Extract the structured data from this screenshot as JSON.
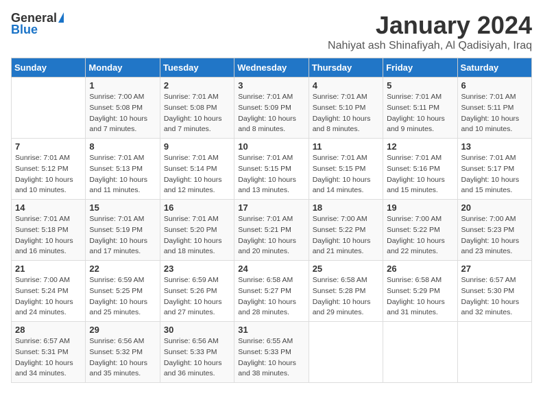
{
  "header": {
    "logo_general": "General",
    "logo_blue": "Blue",
    "month_title": "January 2024",
    "location": "Nahiyat ash Shinafiyah, Al Qadisiyah, Iraq"
  },
  "calendar": {
    "days_of_week": [
      "Sunday",
      "Monday",
      "Tuesday",
      "Wednesday",
      "Thursday",
      "Friday",
      "Saturday"
    ],
    "weeks": [
      [
        {
          "day": "",
          "sunrise": "",
          "sunset": "",
          "daylight": ""
        },
        {
          "day": "1",
          "sunrise": "Sunrise: 7:00 AM",
          "sunset": "Sunset: 5:08 PM",
          "daylight": "Daylight: 10 hours and 7 minutes."
        },
        {
          "day": "2",
          "sunrise": "Sunrise: 7:01 AM",
          "sunset": "Sunset: 5:08 PM",
          "daylight": "Daylight: 10 hours and 7 minutes."
        },
        {
          "day": "3",
          "sunrise": "Sunrise: 7:01 AM",
          "sunset": "Sunset: 5:09 PM",
          "daylight": "Daylight: 10 hours and 8 minutes."
        },
        {
          "day": "4",
          "sunrise": "Sunrise: 7:01 AM",
          "sunset": "Sunset: 5:10 PM",
          "daylight": "Daylight: 10 hours and 8 minutes."
        },
        {
          "day": "5",
          "sunrise": "Sunrise: 7:01 AM",
          "sunset": "Sunset: 5:11 PM",
          "daylight": "Daylight: 10 hours and 9 minutes."
        },
        {
          "day": "6",
          "sunrise": "Sunrise: 7:01 AM",
          "sunset": "Sunset: 5:11 PM",
          "daylight": "Daylight: 10 hours and 10 minutes."
        }
      ],
      [
        {
          "day": "7",
          "sunrise": "Sunrise: 7:01 AM",
          "sunset": "Sunset: 5:12 PM",
          "daylight": "Daylight: 10 hours and 10 minutes."
        },
        {
          "day": "8",
          "sunrise": "Sunrise: 7:01 AM",
          "sunset": "Sunset: 5:13 PM",
          "daylight": "Daylight: 10 hours and 11 minutes."
        },
        {
          "day": "9",
          "sunrise": "Sunrise: 7:01 AM",
          "sunset": "Sunset: 5:14 PM",
          "daylight": "Daylight: 10 hours and 12 minutes."
        },
        {
          "day": "10",
          "sunrise": "Sunrise: 7:01 AM",
          "sunset": "Sunset: 5:15 PM",
          "daylight": "Daylight: 10 hours and 13 minutes."
        },
        {
          "day": "11",
          "sunrise": "Sunrise: 7:01 AM",
          "sunset": "Sunset: 5:15 PM",
          "daylight": "Daylight: 10 hours and 14 minutes."
        },
        {
          "day": "12",
          "sunrise": "Sunrise: 7:01 AM",
          "sunset": "Sunset: 5:16 PM",
          "daylight": "Daylight: 10 hours and 15 minutes."
        },
        {
          "day": "13",
          "sunrise": "Sunrise: 7:01 AM",
          "sunset": "Sunset: 5:17 PM",
          "daylight": "Daylight: 10 hours and 15 minutes."
        }
      ],
      [
        {
          "day": "14",
          "sunrise": "Sunrise: 7:01 AM",
          "sunset": "Sunset: 5:18 PM",
          "daylight": "Daylight: 10 hours and 16 minutes."
        },
        {
          "day": "15",
          "sunrise": "Sunrise: 7:01 AM",
          "sunset": "Sunset: 5:19 PM",
          "daylight": "Daylight: 10 hours and 17 minutes."
        },
        {
          "day": "16",
          "sunrise": "Sunrise: 7:01 AM",
          "sunset": "Sunset: 5:20 PM",
          "daylight": "Daylight: 10 hours and 18 minutes."
        },
        {
          "day": "17",
          "sunrise": "Sunrise: 7:01 AM",
          "sunset": "Sunset: 5:21 PM",
          "daylight": "Daylight: 10 hours and 20 minutes."
        },
        {
          "day": "18",
          "sunrise": "Sunrise: 7:00 AM",
          "sunset": "Sunset: 5:22 PM",
          "daylight": "Daylight: 10 hours and 21 minutes."
        },
        {
          "day": "19",
          "sunrise": "Sunrise: 7:00 AM",
          "sunset": "Sunset: 5:22 PM",
          "daylight": "Daylight: 10 hours and 22 minutes."
        },
        {
          "day": "20",
          "sunrise": "Sunrise: 7:00 AM",
          "sunset": "Sunset: 5:23 PM",
          "daylight": "Daylight: 10 hours and 23 minutes."
        }
      ],
      [
        {
          "day": "21",
          "sunrise": "Sunrise: 7:00 AM",
          "sunset": "Sunset: 5:24 PM",
          "daylight": "Daylight: 10 hours and 24 minutes."
        },
        {
          "day": "22",
          "sunrise": "Sunrise: 6:59 AM",
          "sunset": "Sunset: 5:25 PM",
          "daylight": "Daylight: 10 hours and 25 minutes."
        },
        {
          "day": "23",
          "sunrise": "Sunrise: 6:59 AM",
          "sunset": "Sunset: 5:26 PM",
          "daylight": "Daylight: 10 hours and 27 minutes."
        },
        {
          "day": "24",
          "sunrise": "Sunrise: 6:58 AM",
          "sunset": "Sunset: 5:27 PM",
          "daylight": "Daylight: 10 hours and 28 minutes."
        },
        {
          "day": "25",
          "sunrise": "Sunrise: 6:58 AM",
          "sunset": "Sunset: 5:28 PM",
          "daylight": "Daylight: 10 hours and 29 minutes."
        },
        {
          "day": "26",
          "sunrise": "Sunrise: 6:58 AM",
          "sunset": "Sunset: 5:29 PM",
          "daylight": "Daylight: 10 hours and 31 minutes."
        },
        {
          "day": "27",
          "sunrise": "Sunrise: 6:57 AM",
          "sunset": "Sunset: 5:30 PM",
          "daylight": "Daylight: 10 hours and 32 minutes."
        }
      ],
      [
        {
          "day": "28",
          "sunrise": "Sunrise: 6:57 AM",
          "sunset": "Sunset: 5:31 PM",
          "daylight": "Daylight: 10 hours and 34 minutes."
        },
        {
          "day": "29",
          "sunrise": "Sunrise: 6:56 AM",
          "sunset": "Sunset: 5:32 PM",
          "daylight": "Daylight: 10 hours and 35 minutes."
        },
        {
          "day": "30",
          "sunrise": "Sunrise: 6:56 AM",
          "sunset": "Sunset: 5:33 PM",
          "daylight": "Daylight: 10 hours and 36 minutes."
        },
        {
          "day": "31",
          "sunrise": "Sunrise: 6:55 AM",
          "sunset": "Sunset: 5:33 PM",
          "daylight": "Daylight: 10 hours and 38 minutes."
        },
        {
          "day": "",
          "sunrise": "",
          "sunset": "",
          "daylight": ""
        },
        {
          "day": "",
          "sunrise": "",
          "sunset": "",
          "daylight": ""
        },
        {
          "day": "",
          "sunrise": "",
          "sunset": "",
          "daylight": ""
        }
      ]
    ]
  }
}
